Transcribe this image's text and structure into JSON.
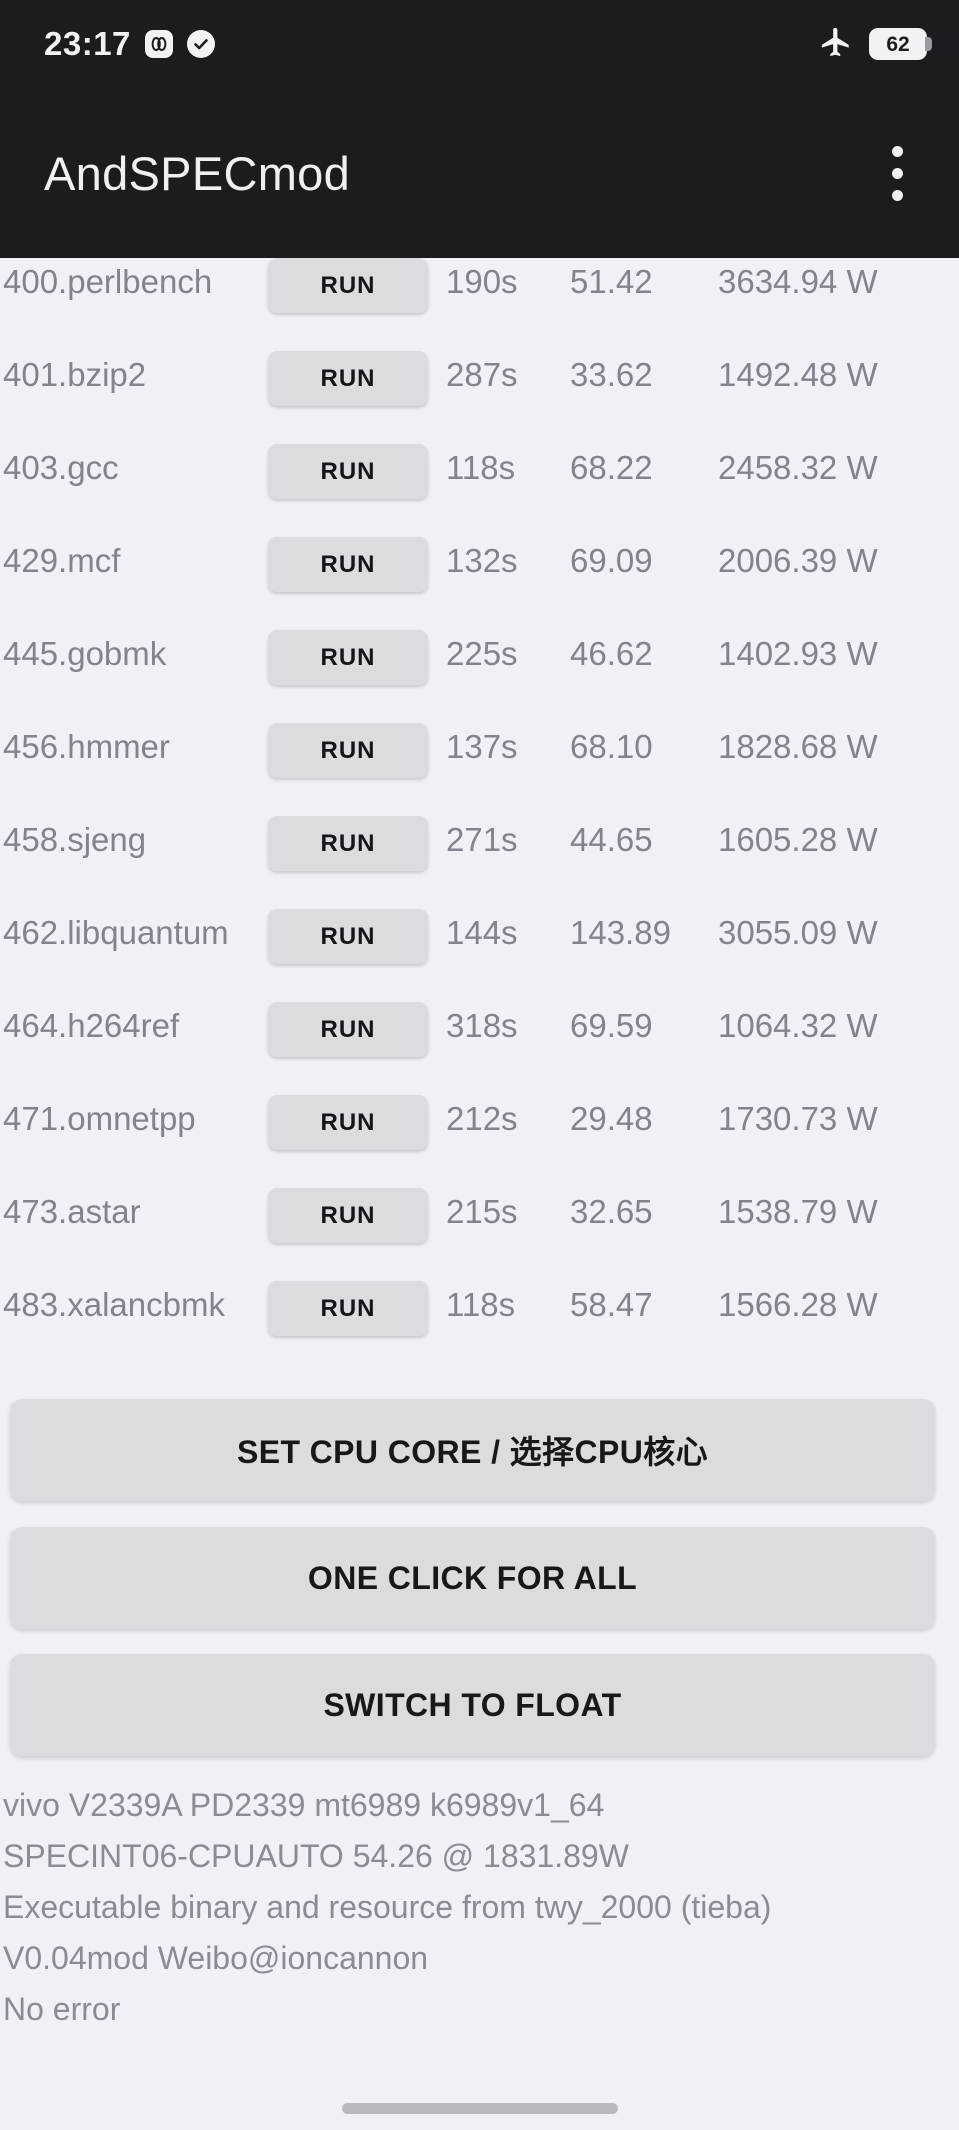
{
  "status_bar": {
    "clock": "23:17",
    "ringer_icon": "vibrate-icon",
    "check_icon": "check-circle-icon",
    "airplane_icon": "airplane-mode-icon",
    "battery_level": "62"
  },
  "app_bar": {
    "title": "AndSPECmod",
    "overflow_icon": "more-vertical-icon"
  },
  "benchmarks": {
    "run_label": "RUN",
    "rows": [
      {
        "name": "400.perlbench",
        "time": "190s",
        "score": "51.42",
        "power": "3634.94 W"
      },
      {
        "name": "401.bzip2",
        "time": "287s",
        "score": "33.62",
        "power": "1492.48 W"
      },
      {
        "name": "403.gcc",
        "time": "118s",
        "score": "68.22",
        "power": "2458.32 W"
      },
      {
        "name": "429.mcf",
        "time": "132s",
        "score": "69.09",
        "power": "2006.39 W"
      },
      {
        "name": "445.gobmk",
        "time": "225s",
        "score": "46.62",
        "power": "1402.93 W"
      },
      {
        "name": "456.hmmer",
        "time": "137s",
        "score": "68.10",
        "power": "1828.68 W"
      },
      {
        "name": "458.sjeng",
        "time": "271s",
        "score": "44.65",
        "power": "1605.28 W"
      },
      {
        "name": "462.libquantum",
        "time": "144s",
        "score": "143.89",
        "power": "3055.09 W"
      },
      {
        "name": "464.h264ref",
        "time": "318s",
        "score": "69.59",
        "power": "1064.32 W"
      },
      {
        "name": "471.omnetpp",
        "time": "212s",
        "score": "29.48",
        "power": "1730.73 W"
      },
      {
        "name": "473.astar",
        "time": "215s",
        "score": "32.65",
        "power": "1538.79 W"
      },
      {
        "name": "483.xalancbmk",
        "time": "118s",
        "score": "58.47",
        "power": "1566.28 W"
      }
    ]
  },
  "actions": {
    "set_cpu_core": "SET CPU CORE / 选择CPU核心",
    "one_click_for_all": "ONE CLICK FOR ALL",
    "switch_to_float": "SWITCH TO FLOAT"
  },
  "footer": {
    "line1": "vivo V2339A PD2339 mt6989 k6989v1_64",
    "line2": "SPECINT06-CPUAUTO  54.26 @ 1831.89W",
    "line3": "Executable binary and resource from twy_2000 (tieba)",
    "line4": "V0.04mod  Weibo@ioncannon",
    "line5": "No error"
  },
  "colors": {
    "app_bar_bg": "#1b1c20",
    "page_bg": "#f1f0f6",
    "button_bg": "#dcdce0",
    "text_muted": "#83838e"
  }
}
